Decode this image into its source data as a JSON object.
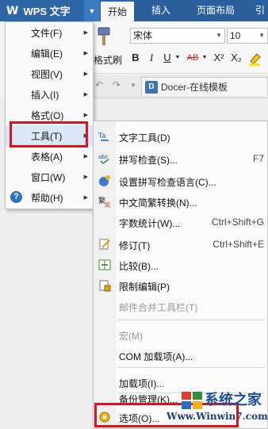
{
  "app": {
    "logo": "W",
    "name": "WPS 文字"
  },
  "ribbon_tabs": [
    "开始",
    "插入",
    "页面布局",
    "引"
  ],
  "ribbon": {
    "format_painter": "格式刷",
    "font_name": "宋体",
    "font_size": "10",
    "format_buttons": [
      "B",
      "I",
      "U",
      "AB",
      "X²",
      "X₂"
    ]
  },
  "doc_tab": {
    "logo": "D",
    "title": "Docer-在线模板"
  },
  "main_menu": [
    {
      "label": "文件(F)",
      "has_sub": true
    },
    {
      "label": "编辑(E)",
      "has_sub": true
    },
    {
      "label": "视图(V)",
      "has_sub": true
    },
    {
      "label": "插入(I)",
      "has_sub": true
    },
    {
      "label": "格式(O)",
      "has_sub": true
    },
    {
      "label": "工具(T)",
      "has_sub": true
    },
    {
      "label": "表格(A)",
      "has_sub": true
    },
    {
      "label": "窗口(W)",
      "has_sub": true
    },
    {
      "label": "帮助(H)",
      "has_sub": true
    }
  ],
  "tools_menu": [
    {
      "label": "文字工具(D)",
      "shortcut": "",
      "disabled": false,
      "icon": "text-tool-icon"
    },
    {
      "label": "拼写检查(S)...",
      "shortcut": "F7",
      "disabled": false,
      "icon": "spell-check-icon"
    },
    {
      "label": "设置拼写检查语言(C)...",
      "shortcut": "",
      "disabled": false,
      "icon": "spell-language-icon"
    },
    {
      "label": "中文简繁转换(N)...",
      "shortcut": "",
      "disabled": false,
      "icon": "chinese-convert-icon"
    },
    {
      "label": "字数统计(W)...",
      "shortcut": "Ctrl+Shift+G",
      "disabled": false,
      "icon": ""
    },
    {
      "label": "修订(T)",
      "shortcut": "Ctrl+Shift+E",
      "disabled": false,
      "icon": "revision-icon"
    },
    {
      "label": "比较(B)...",
      "shortcut": "",
      "disabled": false,
      "icon": "compare-icon"
    },
    {
      "label": "限制编辑(P)",
      "shortcut": "",
      "disabled": false,
      "icon": "restrict-edit-icon"
    },
    {
      "label": "邮件合并工具栏(T)",
      "shortcut": "",
      "disabled": true,
      "icon": ""
    },
    {
      "label": "宏(M)",
      "shortcut": "",
      "disabled": true,
      "icon": ""
    },
    {
      "label": "COM 加载项(A)...",
      "shortcut": "",
      "disabled": false,
      "icon": ""
    },
    {
      "label": "加载项(I)...",
      "shortcut": "",
      "disabled": false,
      "icon": ""
    },
    {
      "label": "备份管理(K)...",
      "shortcut": "",
      "disabled": false,
      "icon": ""
    },
    {
      "label": "选项(O)...",
      "shortcut": "",
      "disabled": false,
      "icon": "options-gear-icon"
    }
  ],
  "watermark": {
    "site_name": "系统之家",
    "url": "Www.Winwin7.com"
  },
  "colors": {
    "title_bar": "#2b5f9c",
    "highlight_box": "#d9141c",
    "menu_hover": "#d9e7f7"
  }
}
